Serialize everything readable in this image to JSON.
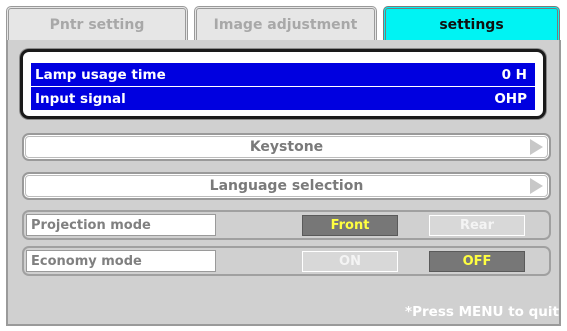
{
  "tabs": [
    {
      "label": "Pntr setting",
      "active": false
    },
    {
      "label": "Image adjustment",
      "active": false
    },
    {
      "label": "settings",
      "active": true
    }
  ],
  "info": {
    "lamp_label": "Lamp usage time",
    "lamp_value": "0 H",
    "input_label": "Input signal",
    "input_value": "OHP"
  },
  "menu": {
    "keystone": "Keystone",
    "language": "Language selection"
  },
  "projection": {
    "label": "Projection mode",
    "options": [
      "Front",
      "Rear"
    ],
    "selected": "Front"
  },
  "economy": {
    "label": "Economy mode",
    "options": [
      "ON",
      "OFF"
    ],
    "selected": "OFF"
  },
  "footer": {
    "hint": "*Press MENU to quit"
  },
  "colors": {
    "active_tab": "#00f3f3",
    "info_row": "#0000e0",
    "selected_option_bg": "#777777",
    "selected_option_text": "#ffff40"
  },
  "icons": [
    "arrow-right-icon"
  ]
}
